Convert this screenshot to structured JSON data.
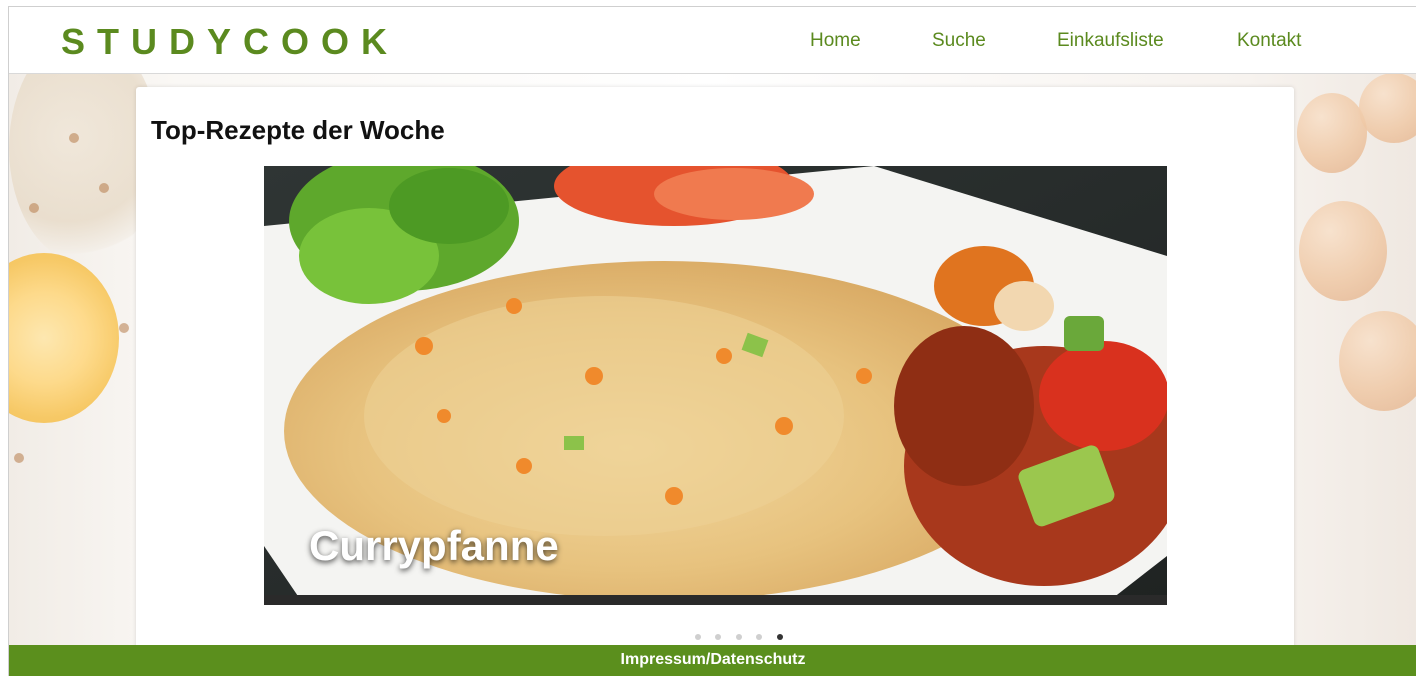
{
  "header": {
    "logo": "STUDYCOOK",
    "nav": [
      {
        "label": "Home"
      },
      {
        "label": "Suche"
      },
      {
        "label": "Einkaufsliste"
      },
      {
        "label": "Kontakt"
      }
    ]
  },
  "main": {
    "section_title": "Top-Rezepte der Woche",
    "carousel": {
      "caption": "Currypfanne",
      "slide_count": 5,
      "active_slide": 5
    }
  },
  "footer": {
    "link": "Impressum/Datenschutz"
  },
  "colors": {
    "brand_green": "#5b8a1f",
    "footer_green": "#5b8f1d"
  }
}
